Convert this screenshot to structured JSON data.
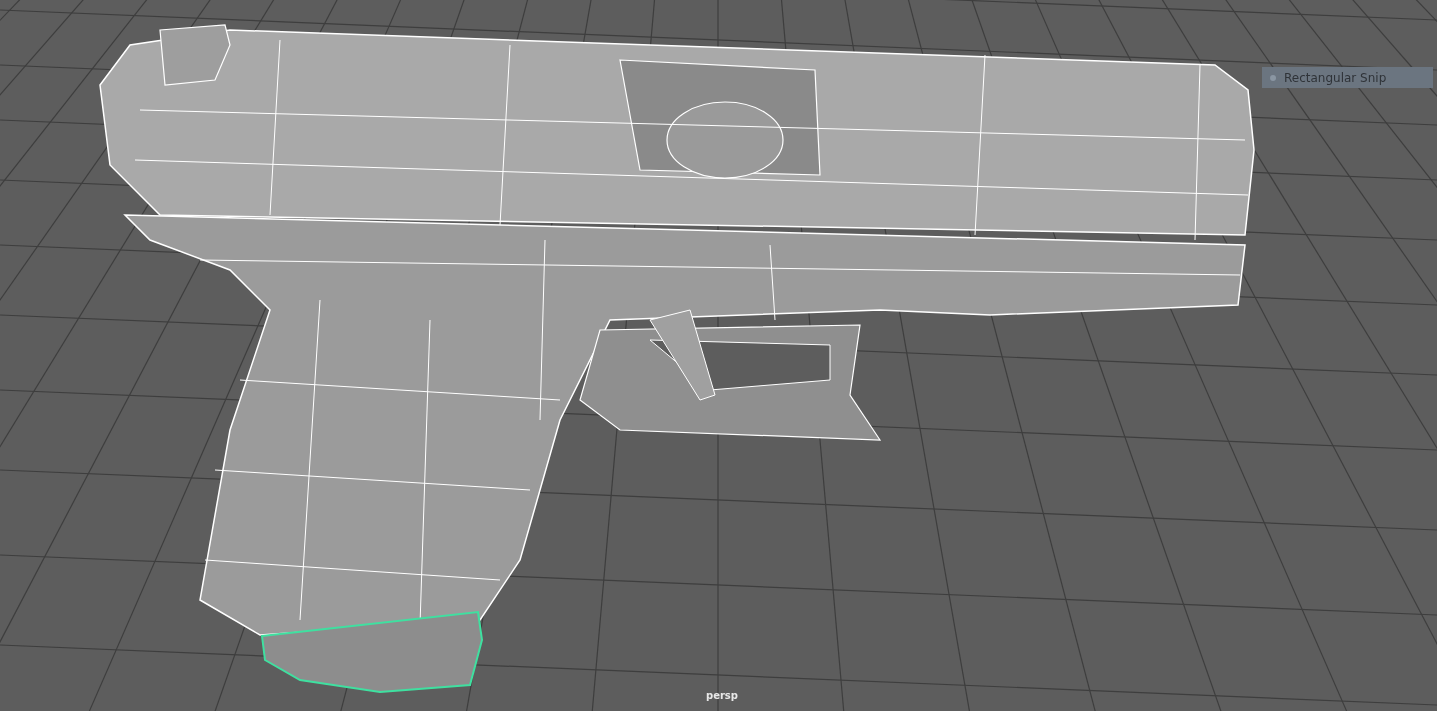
{
  "viewport": {
    "camera_label": "persp"
  },
  "model": {
    "magazine": {
      "selected": true
    }
  },
  "overlay": {
    "label": "Rectangular Snip"
  }
}
